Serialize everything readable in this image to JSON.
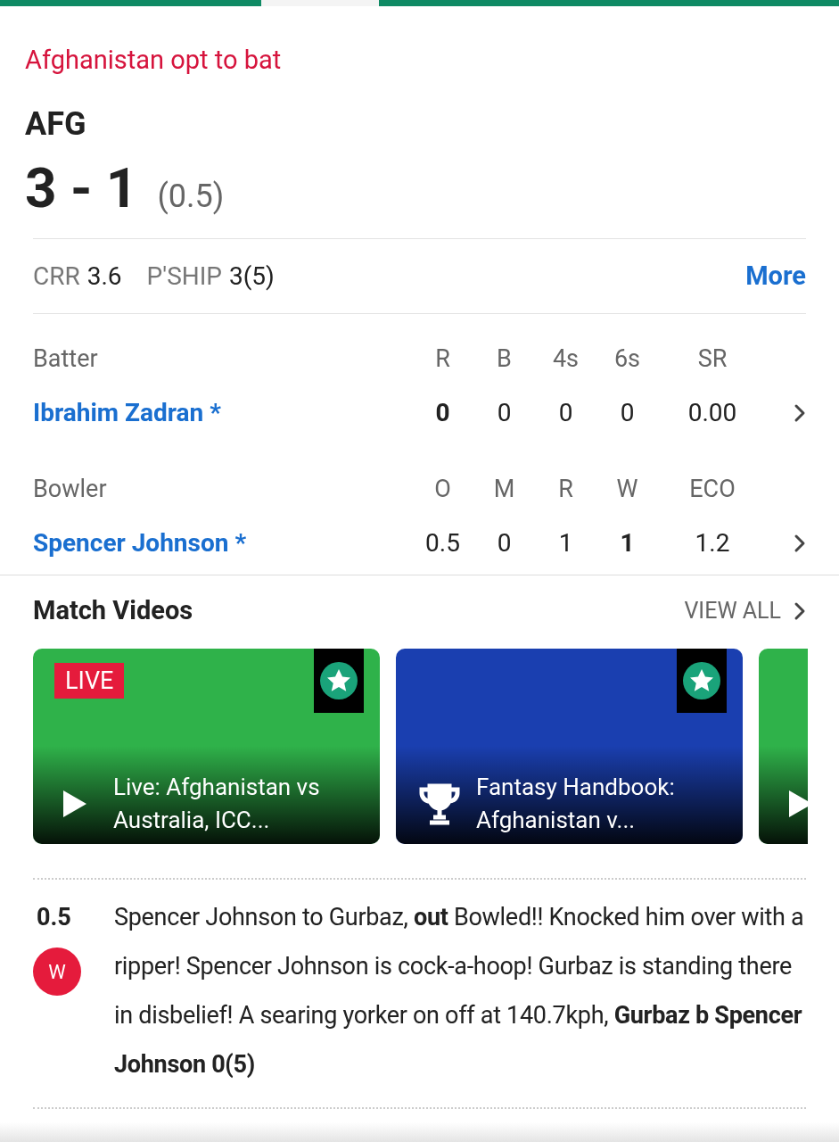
{
  "toss": "Afghanistan opt to bat",
  "team": "AFG",
  "score": "3 - 1",
  "overs": "(0.5)",
  "stats": [
    {
      "label": "CRR",
      "value": "3.6"
    },
    {
      "label": "P'SHIP",
      "value": "3(5)"
    }
  ],
  "more_link": "More",
  "batting": {
    "header": [
      "Batter",
      "R",
      "B",
      "4s",
      "6s",
      "SR"
    ],
    "rows": [
      {
        "name": "Ibrahim Zadran *",
        "values": [
          {
            "text": "0",
            "bold": true
          },
          {
            "text": "0",
            "bold": false
          },
          {
            "text": "0",
            "bold": false
          },
          {
            "text": "0",
            "bold": false
          },
          {
            "text": "0.00",
            "bold": false
          }
        ]
      }
    ]
  },
  "bowling": {
    "header": [
      "Bowler",
      "O",
      "M",
      "R",
      "W",
      "ECO"
    ],
    "rows": [
      {
        "name": "Spencer Johnson *",
        "values": [
          {
            "text": "0.5",
            "bold": false
          },
          {
            "text": "0",
            "bold": false
          },
          {
            "text": "1",
            "bold": false
          },
          {
            "text": "1",
            "bold": true
          },
          {
            "text": "1.2",
            "bold": false
          }
        ]
      }
    ]
  },
  "videos": {
    "title": "Match Videos",
    "view_all": "VIEW ALL",
    "items": [
      {
        "kind": "play",
        "live": true,
        "live_label": "LIVE",
        "title": "Live: Afghanistan vs Australia, ICC...",
        "starred": true
      },
      {
        "kind": "trophy",
        "live": false,
        "title": "Fantasy Handbook: Afghanistan v...",
        "starred": true
      },
      {
        "kind": "play",
        "live": false,
        "starred": false
      }
    ]
  },
  "commentary": [
    {
      "over": "0.5",
      "result": "W",
      "text": "Spencer Johnson to Gurbaz, **out** Bowled!! Knocked him over with a ripper! Spencer Johnson is cock-a-hoop! Gurbaz is standing there in disbelief! A searing yorker on off at 140.7kph, **Gurbaz b Spencer Johnson 0(5)**"
    }
  ]
}
